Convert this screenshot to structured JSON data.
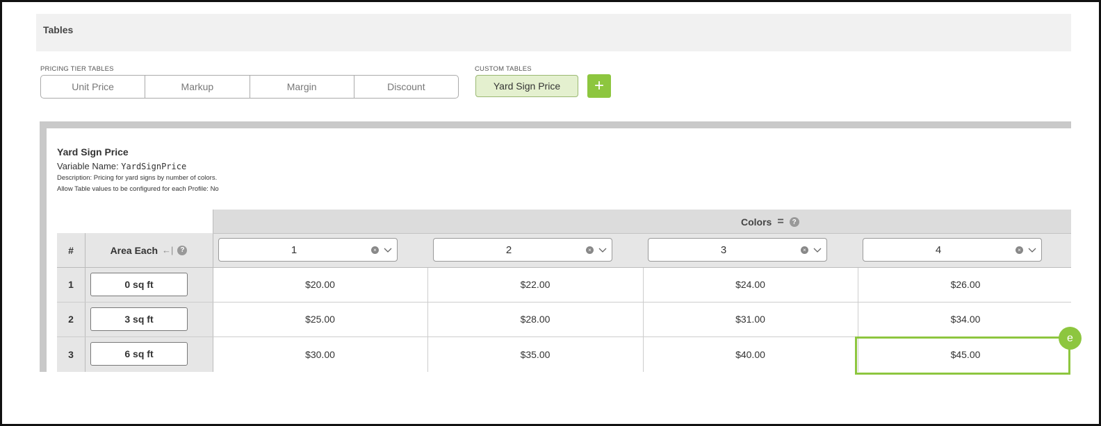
{
  "section": {
    "title": "Tables"
  },
  "pricing_tiers": {
    "label": "PRICING TIER TABLES",
    "buttons": [
      "Unit Price",
      "Markup",
      "Margin",
      "Discount"
    ]
  },
  "custom_tables": {
    "label": "CUSTOM TABLES",
    "selected": "Yard Sign Price",
    "add_label": "+"
  },
  "table": {
    "title": "Yard Sign Price",
    "variable_label": "Variable Name:",
    "variable_name": "YardSignPrice",
    "description": "Description: Pricing for yard signs by number of colors.",
    "allow_profile": "Allow Table values to be configured for each Profile:  No",
    "colors_header": "Colors",
    "row_header_num": "#",
    "row_header_area": "Area Each",
    "area_icon": "←|",
    "help_icon": "?",
    "clear_icon": "×",
    "columns": [
      "1",
      "2",
      "3",
      "4"
    ],
    "rows": [
      {
        "num": "1",
        "area": "0 sq ft",
        "prices": [
          "$20.00",
          "$22.00",
          "$24.00",
          "$26.00"
        ]
      },
      {
        "num": "2",
        "area": "3 sq ft",
        "prices": [
          "$25.00",
          "$28.00",
          "$31.00",
          "$34.00"
        ]
      },
      {
        "num": "3",
        "area": "6 sq ft",
        "prices": [
          "$30.00",
          "$35.00",
          "$40.00",
          "$45.00"
        ]
      }
    ]
  },
  "badge": "e",
  "colors": {
    "accent": "#8dc63f",
    "selected_bg": "#e4f0cf"
  }
}
